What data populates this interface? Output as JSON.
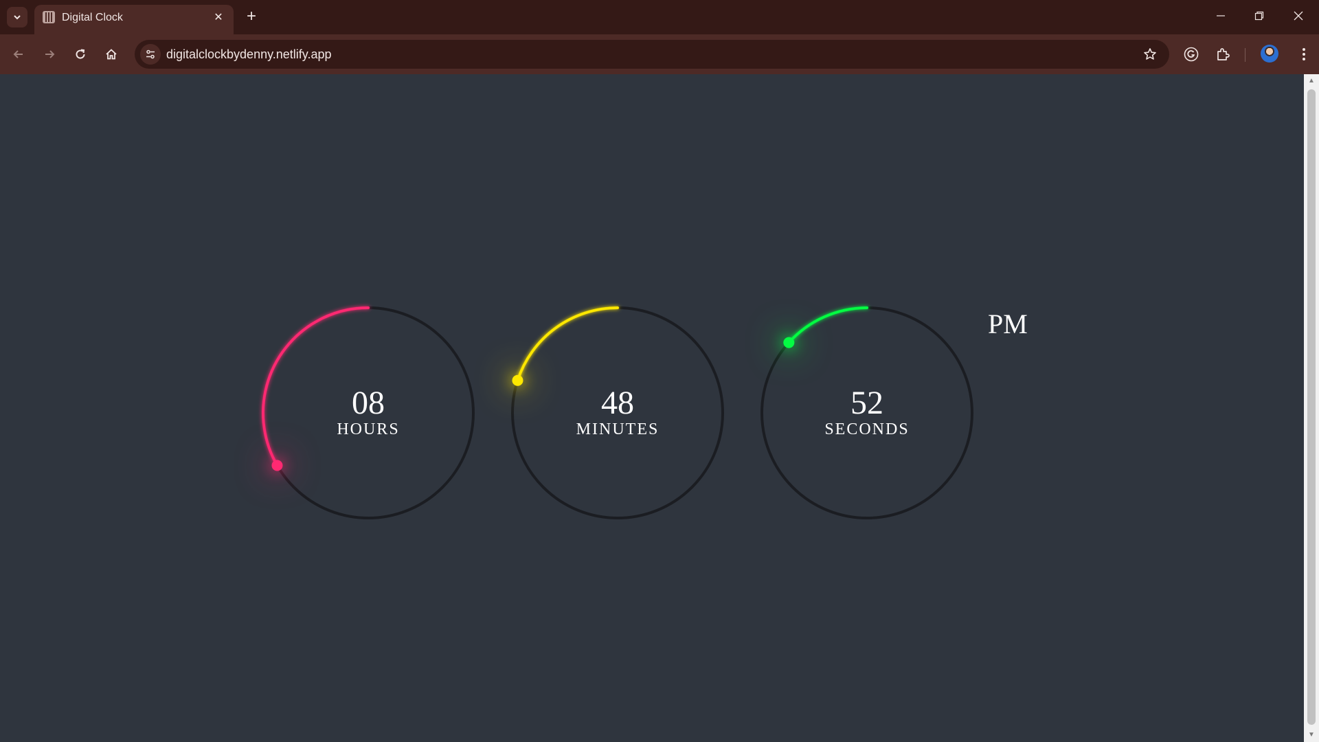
{
  "browser": {
    "tab_title": "Digital Clock",
    "url": "digitalclockbydenny.netlify.app"
  },
  "clock": {
    "hours": {
      "value": "08",
      "label": "HOURS",
      "color": "#ff2972",
      "fraction": 0.6667
    },
    "minutes": {
      "value": "48",
      "label": "MINUTES",
      "color": "#fee800",
      "fraction": 0.8
    },
    "seconds": {
      "value": "52",
      "label": "SECONDS",
      "color": "#04fc43",
      "fraction": 0.8667
    },
    "ampm": "PM"
  }
}
